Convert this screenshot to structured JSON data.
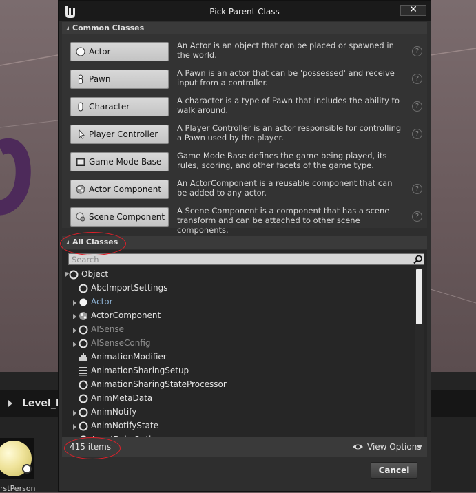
{
  "window": {
    "title": "Pick Parent Class",
    "close_label": "✕"
  },
  "background": {
    "panel_title": "Level_B",
    "asset_label": "rstPerson"
  },
  "common_classes": {
    "header": "Common Classes",
    "items": [
      {
        "label": "Actor",
        "icon": "actor-sphere-icon",
        "desc": "An Actor is an object that can be placed or spawned in the world."
      },
      {
        "label": "Pawn",
        "icon": "pawn-icon",
        "desc": "A Pawn is an actor that can be 'possessed' and receive input from a controller."
      },
      {
        "label": "Character",
        "icon": "character-icon",
        "desc": "A character is a type of Pawn that includes the ability to walk around."
      },
      {
        "label": "Player Controller",
        "icon": "player-controller-icon",
        "desc": "A Player Controller is an actor responsible for controlling a Pawn used by the player."
      },
      {
        "label": "Game Mode Base",
        "icon": "game-mode-icon",
        "desc": "Game Mode Base defines the game being played, its rules, scoring, and other facets of the game type."
      },
      {
        "label": "Actor Component",
        "icon": "actor-component-icon",
        "desc": "An ActorComponent is a reusable component that can be added to any actor."
      },
      {
        "label": "Scene Component",
        "icon": "scene-component-icon",
        "desc": "A Scene Component is a component that has a scene transform and can be attached to other scene components."
      }
    ],
    "help_glyph": "?"
  },
  "all_classes": {
    "header": "All Classes",
    "search_placeholder": "Search",
    "tree": [
      {
        "label": "Object",
        "style": "normal",
        "expander": "open",
        "icon": "circle"
      },
      {
        "label": "AbcImportSettings",
        "style": "normal",
        "expander": "none",
        "icon": "circle"
      },
      {
        "label": "Actor",
        "style": "accent",
        "expander": "closed",
        "icon": "sphere"
      },
      {
        "label": "ActorComponent",
        "style": "normal",
        "expander": "closed",
        "icon": "component"
      },
      {
        "label": "AISense",
        "style": "muted",
        "expander": "closed",
        "icon": "circle"
      },
      {
        "label": "AISenseConfig",
        "style": "muted",
        "expander": "closed",
        "icon": "circle"
      },
      {
        "label": "AnimationModifier",
        "style": "normal",
        "expander": "none",
        "icon": "modifier"
      },
      {
        "label": "AnimationSharingSetup",
        "style": "normal",
        "expander": "none",
        "icon": "grid"
      },
      {
        "label": "AnimationSharingStateProcessor",
        "style": "normal",
        "expander": "none",
        "icon": "circle"
      },
      {
        "label": "AnimMetaData",
        "style": "normal",
        "expander": "none",
        "icon": "circle"
      },
      {
        "label": "AnimNotify",
        "style": "normal",
        "expander": "closed",
        "icon": "circle"
      },
      {
        "label": "AnimNotifyState",
        "style": "normal",
        "expander": "closed",
        "icon": "circle"
      },
      {
        "label": "AssetBakeOptions",
        "style": "normal",
        "expander": "none",
        "icon": "circle"
      }
    ],
    "items_count": "415 items",
    "view_options": "View Options"
  },
  "footer": {
    "cancel_label": "Cancel"
  },
  "colors": {
    "annotation": "#e0202a",
    "accent_text": "#8fb4d6",
    "dialog_bg": "#2e2e2e"
  }
}
